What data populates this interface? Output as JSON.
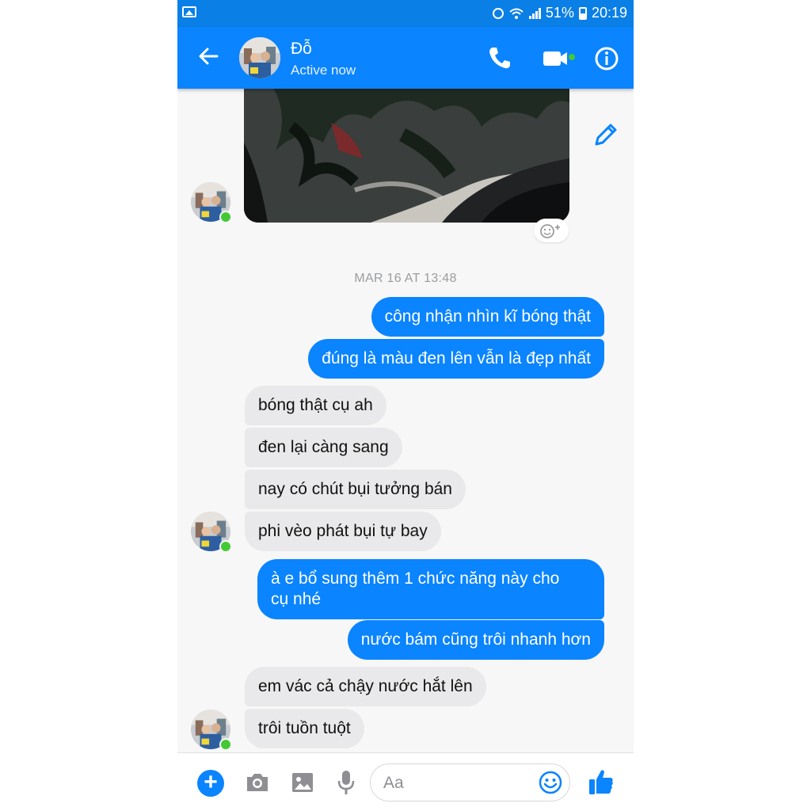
{
  "status_bar": {
    "battery": "51%",
    "time": "20:19"
  },
  "header": {
    "contact_name": "Đỗ",
    "contact_status": "Active now"
  },
  "timestamp": "MAR 16 AT 13:48",
  "messages": [
    {
      "direction": "outgoing",
      "text": "công nhận nhìn kĩ bóng thật"
    },
    {
      "direction": "outgoing",
      "text": "đúng là màu đen lên vẫn là đẹp nhất"
    },
    {
      "direction": "incoming",
      "text": "bóng thật cụ ah"
    },
    {
      "direction": "incoming",
      "text": "đen lại càng sang"
    },
    {
      "direction": "incoming",
      "text": "nay có chút bụi tưởng bán"
    },
    {
      "direction": "incoming",
      "text": "phi vèo phát bụi tự bay"
    },
    {
      "direction": "outgoing",
      "text": "à e bổ sung thêm 1 chức năng này cho",
      "text2": "cụ nhé"
    },
    {
      "direction": "outgoing",
      "text": "nước bám cũng trôi nhanh hơn"
    },
    {
      "direction": "incoming",
      "text": "em vác cả chậy nước hắt lên"
    },
    {
      "direction": "incoming",
      "text": "trôi tuồn tuột"
    }
  ],
  "composer": {
    "placeholder": "Aa"
  },
  "colors": {
    "accent": "#0a84ff",
    "incoming_bubble": "#e9e9eb",
    "online": "#44c935"
  },
  "icons": [
    "back-arrow-icon",
    "phone-icon",
    "video-camera-icon",
    "info-icon",
    "pencil-icon",
    "add-reaction-icon",
    "plus-icon",
    "camera-icon",
    "gallery-icon",
    "microphone-icon",
    "emoji-icon",
    "thumbs-up-icon"
  ]
}
